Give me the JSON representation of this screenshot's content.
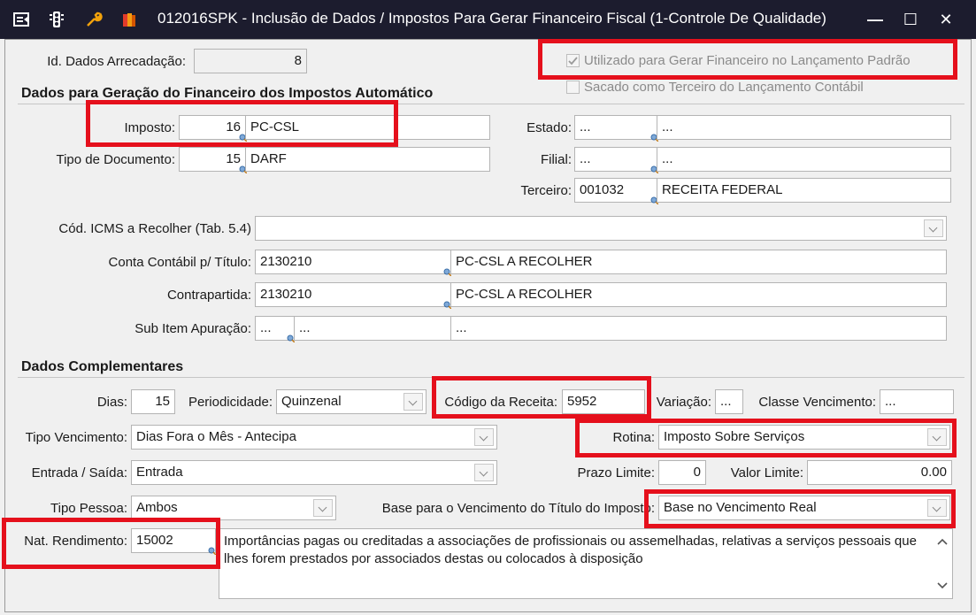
{
  "window": {
    "title": "012016SPK - Inclusão de Dados / Impostos  Para Gerar Financeiro Fiscal (1-Controle De Qualidade)",
    "minimize": "—",
    "maximize": "☐",
    "close": "✕"
  },
  "header": {
    "id_label": "Id. Dados Arrecadação:",
    "id_value": "8",
    "chk_gerar_label": "Utilizado para Gerar Financeiro no Lançamento Padrão",
    "chk_gerar_checked": true,
    "chk_sacado_label": "Sacado como Terceiro do Lançamento Contábil",
    "chk_sacado_checked": false
  },
  "sec1": {
    "title": "Dados para Geração do Financeiro dos Impostos Automático",
    "imposto_label": "Imposto:",
    "imposto_code": "16",
    "imposto_desc": "PC-CSL",
    "tipodoc_label": "Tipo de Documento:",
    "tipodoc_code": "15",
    "tipodoc_desc": "DARF",
    "estado_label": "Estado:",
    "estado_code": "...",
    "estado_desc": "...",
    "filial_label": "Filial:",
    "filial_code": "...",
    "filial_desc": "...",
    "terceiro_label": "Terceiro:",
    "terceiro_code": "001032",
    "terceiro_desc": "RECEITA FEDERAL",
    "icms_label": "Cód. ICMS a Recolher (Tab. 5.4)",
    "icms_value": "",
    "conta_label": "Conta Contábil p/ Título:",
    "conta_code": "2130210",
    "conta_desc": "PC-CSL A RECOLHER",
    "contra_label": "Contrapartida:",
    "contra_code": "2130210",
    "contra_desc": "PC-CSL A RECOLHER",
    "subitem_label": "Sub Item Apuração:",
    "subitem_code": "...",
    "subitem_mid": "...",
    "subitem_desc": "..."
  },
  "sec2": {
    "title": "Dados Complementares",
    "dias_label": "Dias:",
    "dias_value": "15",
    "period_label": "Periodicidade:",
    "period_value": "Quinzenal",
    "codrec_label": "Código da Receita:",
    "codrec_value": "5952",
    "variacao_label": "Variação:",
    "variacao_value": "...",
    "classe_label": "Classe Vencimento:",
    "classe_value": "...",
    "tipovenc_label": "Tipo Vencimento:",
    "tipovenc_value": "Dias Fora o Mês - Antecipa",
    "rotina_label": "Rotina:",
    "rotina_value": "Imposto Sobre Serviços",
    "entrada_label": "Entrada / Saída:",
    "entrada_value": "Entrada",
    "prazo_label": "Prazo Limite:",
    "prazo_value": "0",
    "valor_label": "Valor Limite:",
    "valor_value": "0.00",
    "pessoa_label": "Tipo Pessoa:",
    "pessoa_value": "Ambos",
    "base_label": "Base para o Vencimento do Título do Imposto:",
    "base_value": "Base no Vencimento Real",
    "natrend_label": "Nat. Rendimento:",
    "natrend_value": "15002",
    "natrend_desc": "Importâncias pagas ou creditadas a associações de profissionais ou assemelhadas, relativas a serviços pessoais que lhes forem prestados por associados destas ou colocados à disposição"
  },
  "colors": {
    "highlight": "#e5101c",
    "titlebar": "#1c1c2e"
  }
}
